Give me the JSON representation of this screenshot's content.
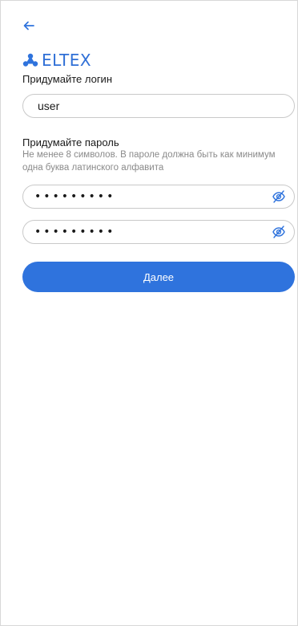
{
  "header": {
    "back_icon": "arrow-left-icon",
    "logo_text": "ELTEX",
    "brand_color": "#2f73dd"
  },
  "login": {
    "label": "Придумайте логин",
    "value": "user"
  },
  "password": {
    "label": "Придумайте пароль",
    "hint": "Не менее 8 символов. В пароле должна быть как минимум одна буква латинского алфавита",
    "value_masked": "•••••••••",
    "confirm_masked": "•••••••••",
    "toggle_icon": "eye-off-icon"
  },
  "actions": {
    "next_label": "Далее"
  }
}
